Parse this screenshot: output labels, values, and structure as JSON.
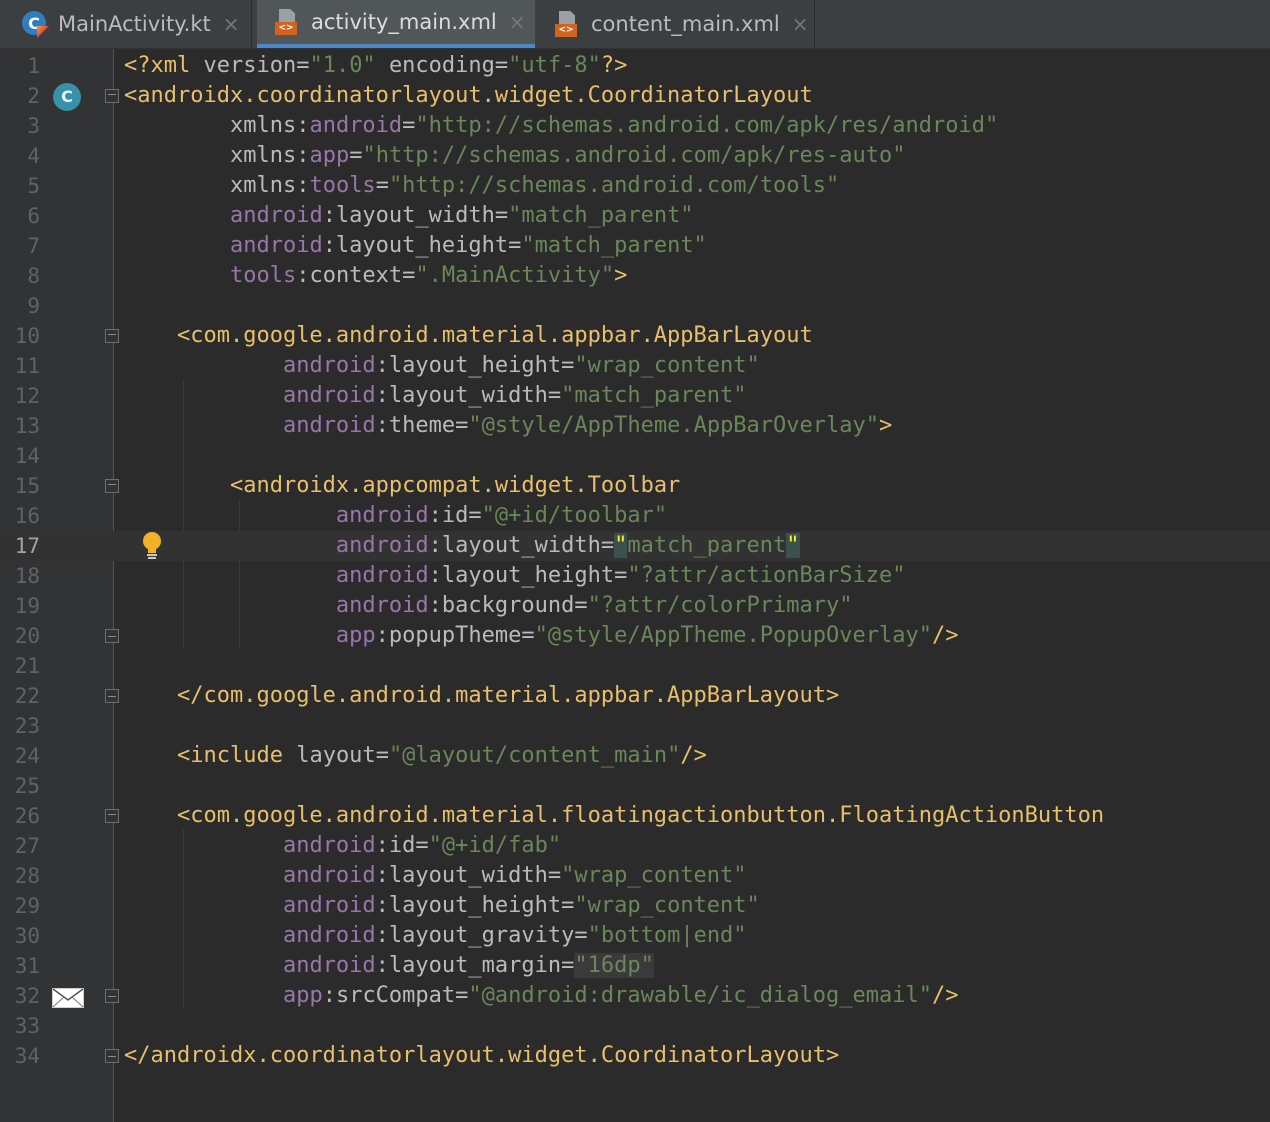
{
  "tabs": [
    {
      "label": "MainActivity.kt",
      "icon": "kotlin-class-icon",
      "active": false
    },
    {
      "label": "activity_main.xml",
      "icon": "xml-layout-icon",
      "active": true
    },
    {
      "label": "content_main.xml",
      "icon": "xml-layout-icon",
      "active": false
    }
  ],
  "tab_close_glyph": "×",
  "gutter": {
    "class_badge_letter": "C",
    "current_line": 17
  },
  "colors": {
    "background": "#2b2b2b",
    "tag": "#e8bf6a",
    "attribute_namespace": "#9876aa",
    "attribute_name": "#bababa",
    "string": "#6a8759",
    "line_number": "#606366",
    "active_tab_underline": "#4a88c7"
  },
  "lines": [
    {
      "n": "1",
      "text": "<?xml version=\"1.0\" encoding=\"utf-8\"?>"
    },
    {
      "n": "2",
      "text": "<androidx.coordinatorlayout.widget.CoordinatorLayout"
    },
    {
      "n": "3",
      "text": "        xmlns:android=\"http://schemas.android.com/apk/res/android\""
    },
    {
      "n": "4",
      "text": "        xmlns:app=\"http://schemas.android.com/apk/res-auto\""
    },
    {
      "n": "5",
      "text": "        xmlns:tools=\"http://schemas.android.com/tools\""
    },
    {
      "n": "6",
      "text": "        android:layout_width=\"match_parent\""
    },
    {
      "n": "7",
      "text": "        android:layout_height=\"match_parent\""
    },
    {
      "n": "8",
      "text": "        tools:context=\".MainActivity\">"
    },
    {
      "n": "9",
      "text": ""
    },
    {
      "n": "10",
      "text": "    <com.google.android.material.appbar.AppBarLayout"
    },
    {
      "n": "11",
      "text": "            android:layout_height=\"wrap_content\""
    },
    {
      "n": "12",
      "text": "            android:layout_width=\"match_parent\""
    },
    {
      "n": "13",
      "text": "            android:theme=\"@style/AppTheme.AppBarOverlay\">"
    },
    {
      "n": "14",
      "text": ""
    },
    {
      "n": "15",
      "text": "        <androidx.appcompat.widget.Toolbar"
    },
    {
      "n": "16",
      "text": "                android:id=\"@+id/toolbar\""
    },
    {
      "n": "17",
      "text": "                android:layout_width=\"match_parent\""
    },
    {
      "n": "18",
      "text": "                android:layout_height=\"?attr/actionBarSize\""
    },
    {
      "n": "19",
      "text": "                android:background=\"?attr/colorPrimary\""
    },
    {
      "n": "20",
      "text": "                app:popupTheme=\"@style/AppTheme.PopupOverlay\"/>"
    },
    {
      "n": "21",
      "text": ""
    },
    {
      "n": "22",
      "text": "    </com.google.android.material.appbar.AppBarLayout>"
    },
    {
      "n": "23",
      "text": ""
    },
    {
      "n": "24",
      "text": "    <include layout=\"@layout/content_main\"/>"
    },
    {
      "n": "25",
      "text": ""
    },
    {
      "n": "26",
      "text": "    <com.google.android.material.floatingactionbutton.FloatingActionButton"
    },
    {
      "n": "27",
      "text": "            android:id=\"@+id/fab\""
    },
    {
      "n": "28",
      "text": "            android:layout_width=\"wrap_content\""
    },
    {
      "n": "29",
      "text": "            android:layout_height=\"wrap_content\""
    },
    {
      "n": "30",
      "text": "            android:layout_gravity=\"bottom|end\""
    },
    {
      "n": "31",
      "text": "            android:layout_margin=\"16dp\""
    },
    {
      "n": "32",
      "text": "            app:srcCompat=\"@android:drawable/ic_dialog_email\"/>"
    },
    {
      "n": "33",
      "text": ""
    },
    {
      "n": "34",
      "text": "</androidx.coordinatorlayout.widget.CoordinatorLayout>"
    }
  ]
}
